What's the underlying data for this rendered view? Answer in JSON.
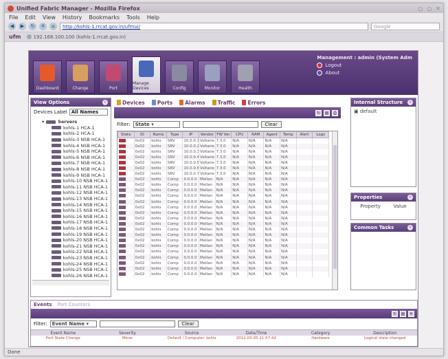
{
  "browser": {
    "title": "Unified Fabric Manager - Mozilla Firefox",
    "menu": [
      "File",
      "Edit",
      "View",
      "History",
      "Bookmarks",
      "Tools",
      "Help"
    ],
    "url": "http://kohls-1.rrcat.gov.in/ufmui/",
    "search_placeholder": "Google",
    "tab_label": "192.168.100.100 (kohls-1.rrcat.gov.in)",
    "tab_icon": "ufm",
    "status": "Done"
  },
  "app": {
    "nav": [
      {
        "label": "Dashboard",
        "icon": "dashboard-icon",
        "color": "#e65a2a"
      },
      {
        "label": "Change",
        "icon": "change-icon",
        "color": "#d8a060"
      },
      {
        "label": "Port",
        "icon": "port-icon",
        "color": "#c04a70"
      },
      {
        "label": "Manage Devices",
        "icon": "manage-devices-icon",
        "color": "#4a68b8"
      },
      {
        "label": "Config",
        "icon": "config-icon",
        "color": "#8a8aa0"
      },
      {
        "label": "Monitor",
        "icon": "monitor-icon",
        "color": "#9aa0c0"
      },
      {
        "label": "Health",
        "icon": "health-icon",
        "color": "#a0a0b0"
      }
    ],
    "management": {
      "label": "Management : admin (System Adm",
      "logout": "Logout",
      "about": "About"
    },
    "left": {
      "title": "View Options",
      "devices_label": "Devices Label",
      "devices_value": "All Names",
      "root": "Servers",
      "items": [
        "kohls-1 HCA-1",
        "kohls-2 HCA-1",
        "kohls-3 NSB HCA-1",
        "kohls-4 NSB HCA-1",
        "kohls-5 NSB HCA-1",
        "kohls-6 NSB HCA-1",
        "kohls-7 NSB HCA-1",
        "kohls-8 NSB HCA-1",
        "kohls-9 NSB HCA-1",
        "kohls-10 NSB HCA-1",
        "kohls-11 NSB HCA-1",
        "kohls-12 NSB HCA-1",
        "kohls-13 NSB HCA-1",
        "kohls-14 NSB HCA-1",
        "kohls-15 NSB HCA-1",
        "kohls-16 NSB HCA-1",
        "kohls-17 NSB HCA-1",
        "kohls-18 NSB HCA-1",
        "kohls-19 NSB HCA-1",
        "kohls-20 NSB HCA-1",
        "kohls-21 NSB HCA-1",
        "kohls-22 NSB HCA-1",
        "kohls-23 NSB HCA-1",
        "kohls-24 NSB HCA-1",
        "kohls-25 NSB HCA-1",
        "kohls-26 NSB HCA-1"
      ]
    },
    "center": {
      "tabs": [
        "Devices",
        "Ports",
        "Alarms",
        "Traffic",
        "Errors"
      ],
      "filter_label": "Filter:",
      "filter_field": "State",
      "clear": "Clear",
      "columns": [
        "State",
        "ID",
        "Name",
        "Type",
        "IP",
        "Vendor",
        "FW Ver",
        "CPU",
        "RAM",
        "Agent",
        "Temp",
        "Alert",
        "Logs"
      ],
      "rows": [
        {
          "alert": true,
          "cells": [
            "0x02",
            "kohls",
            "SRV",
            "10.0.0.1",
            "Voltaire",
            "7.3.0",
            "N/A",
            "N/A",
            "N/A",
            "N/A",
            "",
            ""
          ]
        },
        {
          "alert": true,
          "cells": [
            "0x02",
            "kohls",
            "SRV",
            "10.0.0.2",
            "Voltaire",
            "7.3.0",
            "N/A",
            "N/A",
            "N/A",
            "N/A",
            "",
            ""
          ]
        },
        {
          "alert": true,
          "cells": [
            "0x02",
            "kohls",
            "SRV",
            "10.0.0.3",
            "Voltaire",
            "7.3.0",
            "N/A",
            "N/A",
            "N/A",
            "N/A",
            "",
            ""
          ]
        },
        {
          "alert": true,
          "cells": [
            "0x02",
            "kohls",
            "SRV",
            "10.0.0.4",
            "Voltaire",
            "7.3.0",
            "N/A",
            "N/A",
            "N/A",
            "N/A",
            "",
            ""
          ]
        },
        {
          "alert": true,
          "cells": [
            "0x02",
            "kohls",
            "SRV",
            "10.0.0.5",
            "Voltaire",
            "7.3.0",
            "N/A",
            "N/A",
            "N/A",
            "N/A",
            "",
            ""
          ]
        },
        {
          "alert": true,
          "cells": [
            "0x02",
            "kohls",
            "SRV",
            "10.0.0.6",
            "Voltaire",
            "7.3.0",
            "N/A",
            "N/A",
            "N/A",
            "N/A",
            "",
            ""
          ]
        },
        {
          "alert": true,
          "cells": [
            "0x02",
            "kohls",
            "SRV",
            "10.0.0.7",
            "Voltaire",
            "7.3.0",
            "N/A",
            "N/A",
            "N/A",
            "N/A",
            "",
            ""
          ]
        },
        {
          "alert": false,
          "cells": [
            "0x02",
            "kohls",
            "Comp",
            "0.0.0.0",
            "Mellan",
            "N/A",
            "N/A",
            "N/A",
            "N/A",
            "N/A",
            "",
            ""
          ]
        },
        {
          "alert": false,
          "cells": [
            "0x02",
            "kohls",
            "Comp",
            "0.0.0.0",
            "Mellan",
            "N/A",
            "N/A",
            "N/A",
            "N/A",
            "N/A",
            "",
            ""
          ]
        },
        {
          "alert": false,
          "cells": [
            "0x02",
            "kohls",
            "Comp",
            "0.0.0.0",
            "Mellan",
            "N/A",
            "N/A",
            "N/A",
            "N/A",
            "N/A",
            "",
            ""
          ]
        },
        {
          "alert": false,
          "cells": [
            "0x02",
            "kohls",
            "Comp",
            "0.0.0.0",
            "Mellan",
            "N/A",
            "N/A",
            "N/A",
            "N/A",
            "N/A",
            "",
            ""
          ]
        },
        {
          "alert": false,
          "cells": [
            "0x02",
            "kohls",
            "Comp",
            "0.0.0.0",
            "Mellan",
            "N/A",
            "N/A",
            "N/A",
            "N/A",
            "N/A",
            "",
            ""
          ]
        },
        {
          "alert": false,
          "cells": [
            "0x02",
            "kohls",
            "Comp",
            "0.0.0.0",
            "Mellan",
            "N/A",
            "N/A",
            "N/A",
            "N/A",
            "N/A",
            "",
            ""
          ]
        },
        {
          "alert": false,
          "cells": [
            "0x02",
            "kohls",
            "Comp",
            "0.0.0.0",
            "Mellan",
            "N/A",
            "N/A",
            "N/A",
            "N/A",
            "N/A",
            "",
            ""
          ]
        },
        {
          "alert": false,
          "cells": [
            "0x02",
            "kohls",
            "Comp",
            "0.0.0.0",
            "Mellan",
            "N/A",
            "N/A",
            "N/A",
            "N/A",
            "N/A",
            "",
            ""
          ]
        },
        {
          "alert": false,
          "cells": [
            "0x02",
            "kohls",
            "Comp",
            "0.0.0.0",
            "Mellan",
            "N/A",
            "N/A",
            "N/A",
            "N/A",
            "N/A",
            "",
            ""
          ]
        },
        {
          "alert": false,
          "cells": [
            "0x02",
            "kohls",
            "Comp",
            "0.0.0.0",
            "Mellan",
            "N/A",
            "N/A",
            "N/A",
            "N/A",
            "N/A",
            "",
            ""
          ]
        },
        {
          "alert": false,
          "cells": [
            "0x02",
            "kohls",
            "Comp",
            "0.0.0.0",
            "Mellan",
            "N/A",
            "N/A",
            "N/A",
            "N/A",
            "N/A",
            "",
            ""
          ]
        },
        {
          "alert": false,
          "cells": [
            "0x02",
            "kohls",
            "Comp",
            "0.0.0.0",
            "Mellan",
            "N/A",
            "N/A",
            "N/A",
            "N/A",
            "N/A",
            "",
            ""
          ]
        },
        {
          "alert": false,
          "cells": [
            "0x02",
            "kohls",
            "Comp",
            "0.0.0.0",
            "Mellan",
            "N/A",
            "N/A",
            "N/A",
            "N/A",
            "N/A",
            "",
            ""
          ]
        },
        {
          "alert": false,
          "cells": [
            "0x02",
            "kohls",
            "Comp",
            "0.0.0.0",
            "Mellan",
            "N/A",
            "N/A",
            "N/A",
            "N/A",
            "N/A",
            "",
            ""
          ]
        },
        {
          "alert": false,
          "cells": [
            "0x02",
            "kohls",
            "Comp",
            "0.0.0.0",
            "Mellan",
            "N/A",
            "N/A",
            "N/A",
            "N/A",
            "N/A",
            "",
            ""
          ]
        },
        {
          "alert": false,
          "cells": [
            "0x02",
            "kohls",
            "Comp",
            "0.0.0.0",
            "Mellan",
            "N/A",
            "N/A",
            "N/A",
            "N/A",
            "N/A",
            "",
            ""
          ]
        },
        {
          "alert": false,
          "cells": [
            "0x02",
            "kohls",
            "Comp",
            "0.0.0.0",
            "Mellan",
            "N/A",
            "N/A",
            "N/A",
            "N/A",
            "N/A",
            "",
            ""
          ]
        },
        {
          "alert": false,
          "cells": [
            "0x02",
            "kohls",
            "Comp",
            "0.0.0.0",
            "Mellan",
            "N/A",
            "N/A",
            "N/A",
            "N/A",
            "N/A",
            "",
            ""
          ]
        }
      ]
    },
    "right": {
      "fabric_title": "Internal Structure",
      "fabric_item": "default",
      "properties_title": "Properties",
      "prop_cols": [
        "Property",
        "Value"
      ],
      "tasks_title": "Common Tasks"
    },
    "bottom": {
      "tabs": [
        "Events",
        "Port Counters"
      ],
      "filter_label": "Filter:",
      "filter_field": "Event Name",
      "clear": "Clear",
      "columns": [
        "Event Name",
        "Severity",
        "Source",
        "Date/Time",
        "Category",
        "Description"
      ],
      "row": [
        "Port State Change",
        "Minor",
        "Default / Computer: kohls",
        "2012-03-05 11:57:42",
        "Hardware",
        "Logical state changed"
      ]
    }
  }
}
